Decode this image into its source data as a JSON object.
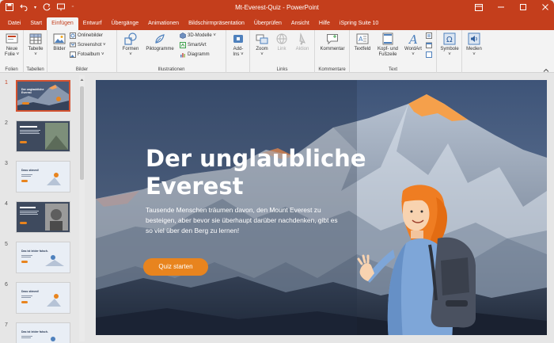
{
  "window": {
    "title": "Mt-Everest-Quiz  -  PowerPoint",
    "colors": {
      "brand": "#c43e1c",
      "accent_orange": "#e8841e",
      "selected_thumb": "#d35230"
    }
  },
  "tabs": [
    "Datei",
    "Start",
    "Einfügen",
    "Entwurf",
    "Übergänge",
    "Animationen",
    "Bildschirmpräsentation",
    "Überprüfen",
    "Ansicht",
    "Hilfe",
    "iSpring Suite 10"
  ],
  "active_tab": "Einfügen",
  "ribbon": {
    "folien": {
      "label": "Folien",
      "neue_folie": "Neue",
      "neue_folie2": "Folie ˅"
    },
    "tabellen": {
      "label": "Tabellen",
      "tabelle": "Tabelle",
      "tabelle_arrow": "˅"
    },
    "bilder": {
      "label": "Bilder",
      "bilder": "Bilder",
      "onlinebilder": "Onlinebilder",
      "screenshot": "Screenshot ˅",
      "fotoalbum": "Fotoalbum ˅"
    },
    "illustrationen": {
      "label": "Illustrationen",
      "formen": "Formen",
      "formen_arrow": "˅",
      "piktogramme": "Piktogramme",
      "modelle": "3D-Modelle ˅",
      "smartart": "SmartArt",
      "diagramm": "Diagramm"
    },
    "addins": {
      "label": "",
      "addins": "Add-",
      "addins2": "Ins ˅"
    },
    "links": {
      "label": "Links",
      "zoom": "Zoom",
      "zoom_arrow": "˅",
      "link": "Link",
      "aktion": "Aktion"
    },
    "kommentare": {
      "label": "Kommentare",
      "kommentar": "Kommentar"
    },
    "text": {
      "label": "Text",
      "textfeld": "Textfeld",
      "kopf": "Kopf- und",
      "kopf2": "Fußzeile",
      "wordart": "WordArt",
      "wordart_arrow": "˅"
    },
    "symbole": {
      "symbole": "Symbole",
      "arrow": "˅"
    },
    "medien": {
      "medien": "Medien",
      "arrow": "˅"
    }
  },
  "thumbnails": [
    {
      "num": "1",
      "line1": "Der unglaubliche",
      "line2": "Everest"
    },
    {
      "num": "2",
      "line1": ""
    },
    {
      "num": "3",
      "line1": "Dass stimmt!"
    },
    {
      "num": "4",
      "line1": ""
    },
    {
      "num": "5",
      "line1": "Das ist leider falsch."
    },
    {
      "num": "6",
      "line1": "Dass stimmt!"
    },
    {
      "num": "7",
      "line1": "Das ist leider falsch."
    }
  ],
  "slide": {
    "title_line1": "Der unglaubliche",
    "title_line2": "Everest",
    "body": "Tausende Menschen träumen davon, den Mount Everest zu besteigen, aber bevor sie überhaupt darüber nachdenken, gibt es so viel über den Berg zu lernen!",
    "button": "Quiz starten"
  }
}
